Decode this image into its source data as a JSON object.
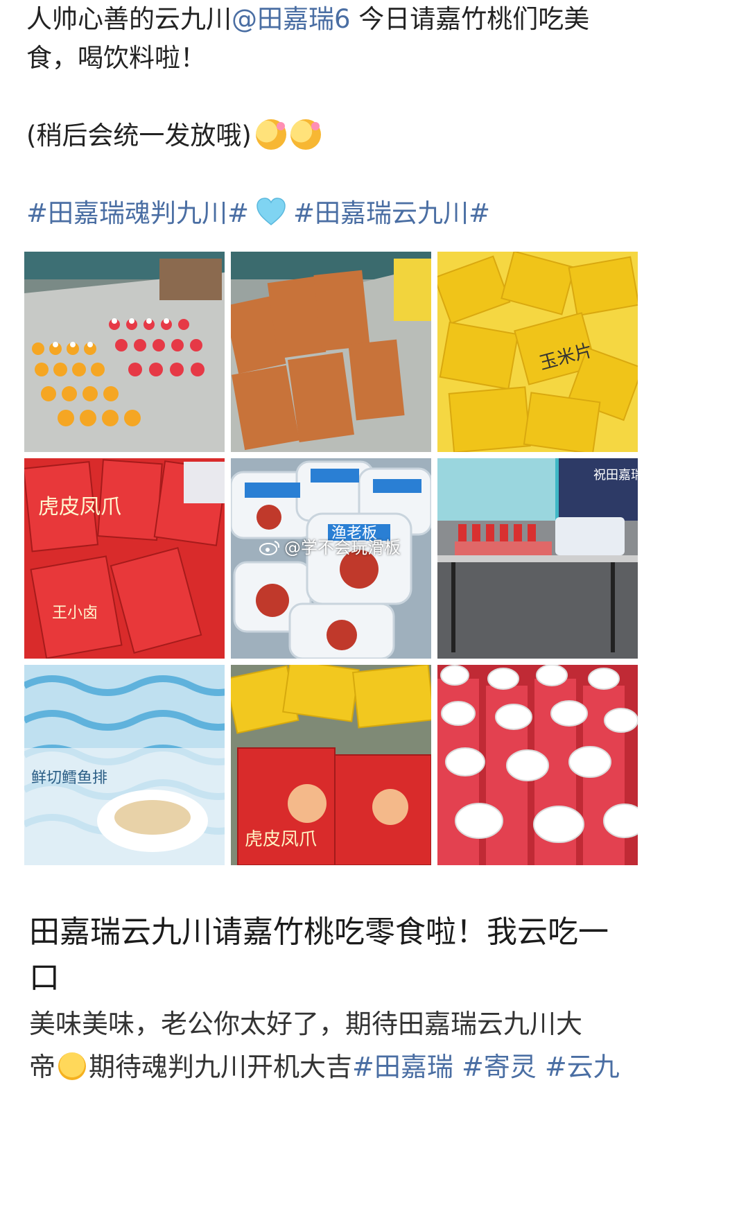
{
  "post": {
    "line1_prefix": "人帅心善的云九川",
    "mention": "@田嘉瑞6",
    "line1_suffix": " 今日请嘉竹桃们吃美",
    "line2": "食，喝饮料啦！",
    "line3": "(稍后会统一发放哦)",
    "topic1": "#田嘉瑞魂判九川#",
    "topic2": "#田嘉瑞云九川#"
  },
  "watermark": "@学不会玩滑板",
  "images": [
    {
      "name": "drinks-on-table",
      "labels": []
    },
    {
      "name": "snack-bags-brown",
      "labels": []
    },
    {
      "name": "corn-chips-yellow",
      "labels": [
        "玉米片"
      ]
    },
    {
      "name": "tiger-skin-chicken-feet",
      "labels": [
        "虎皮凤爪",
        "王小卤"
      ]
    },
    {
      "name": "yulaoban-boxes",
      "labels": [
        "渔老板"
      ]
    },
    {
      "name": "snack-table-wide",
      "labels": [
        "祝田嘉瑞"
      ]
    },
    {
      "name": "fresh-cod-fillet",
      "labels": [
        "鲜切鳕鱼排"
      ]
    },
    {
      "name": "mixed-snacks",
      "labels": [
        "虎皮凤爪"
      ]
    },
    {
      "name": "red-juice-bottles",
      "labels": []
    }
  ],
  "article": {
    "title_line1": "田嘉瑞云九川请嘉竹桃吃零食啦！我云吃一",
    "title_line2": "口",
    "body_line1": "美味美味，老公你太好了，期待田嘉瑞云九川大",
    "body_line2_a": "帝",
    "body_line2_b": "期待魂判九川开机大吉",
    "body_topic1": "#田嘉瑞",
    "body_topic2": "#寄灵",
    "body_topic3": "#云九"
  },
  "colors": {
    "link": "#4a6ea3",
    "text": "#222222"
  },
  "icons": [
    "smiling-flower-emoji",
    "light-blue-heart-emoji",
    "smile-emoji",
    "weibo-logo-icon"
  ]
}
